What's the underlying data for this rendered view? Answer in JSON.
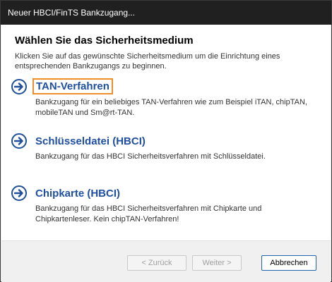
{
  "window": {
    "title": "Neuer HBCI/FinTS Bankzugang..."
  },
  "page": {
    "heading": "Wählen Sie das Sicherheitsmedium",
    "subtext": "Klicken Sie auf das gewünschte Sicherheitsmedium um die Einrichtung eines entsprechenden Bankzugangs zu beginnen."
  },
  "options": [
    {
      "title": "TAN-Verfahren",
      "description": "Bankzugang für ein beliebiges TAN-Verfahren wie zum Beispiel iTAN, chipTAN, mobileTAN und Sm@rt-TAN."
    },
    {
      "title": "Schlüsseldatei (HBCI)",
      "description": "Bankzugang für das HBCI Sicherheitsverfahren mit Schlüsseldatei."
    },
    {
      "title": "Chipkarte (HBCI)",
      "description": "Bankzugang für das HBCI Sicherheitsverfahren mit Chipkarte und Chipkartenleser. Kein chipTAN-Verfahren!"
    }
  ],
  "buttons": {
    "back": "< Zurück",
    "next": "Weiter >",
    "cancel": "Abbrechen"
  },
  "colors": {
    "accent": "#1f4fa2",
    "focus_border": "#f08c2a"
  },
  "icons": {
    "option_arrow": "arrow-right-circle-icon"
  }
}
